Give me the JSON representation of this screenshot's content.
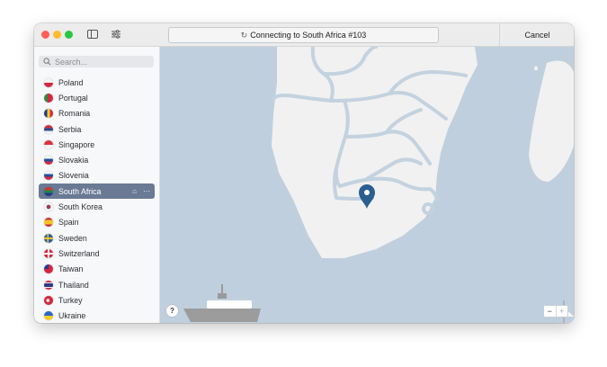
{
  "titlebar": {
    "status_text": "Connecting to South Africa #103",
    "cancel_label": "Cancel"
  },
  "search": {
    "placeholder": "Search..."
  },
  "countries": [
    {
      "label": "Poland",
      "flag": "poland"
    },
    {
      "label": "Portugal",
      "flag": "portugal"
    },
    {
      "label": "Romania",
      "flag": "romania"
    },
    {
      "label": "Serbia",
      "flag": "serbia"
    },
    {
      "label": "Singapore",
      "flag": "singapore"
    },
    {
      "label": "Slovakia",
      "flag": "slovakia"
    },
    {
      "label": "Slovenia",
      "flag": "slovenia"
    },
    {
      "label": "South Africa",
      "flag": "south-africa",
      "selected": true
    },
    {
      "label": "South Korea",
      "flag": "south-korea"
    },
    {
      "label": "Spain",
      "flag": "spain"
    },
    {
      "label": "Sweden",
      "flag": "sweden"
    },
    {
      "label": "Switzerland",
      "flag": "switzerland"
    },
    {
      "label": "Taiwan",
      "flag": "taiwan"
    },
    {
      "label": "Thailand",
      "flag": "thailand"
    },
    {
      "label": "Turkey",
      "flag": "turkey"
    },
    {
      "label": "Ukraine",
      "flag": "ukraine"
    }
  ],
  "map": {
    "help_label": "?",
    "zoom_out_label": "−",
    "zoom_in_label": "+"
  },
  "colors": {
    "selected_row": "#6a7a95",
    "map_water": "#bfcfdd",
    "map_land": "#f1f1f1",
    "pin": "#2a5f8f"
  },
  "icons": [
    "sidebar-icon",
    "settings-sliders-icon",
    "spinner-icon",
    "search-icon",
    "pin-icon",
    "ship-icon",
    "boat-icon",
    "help-icon"
  ]
}
